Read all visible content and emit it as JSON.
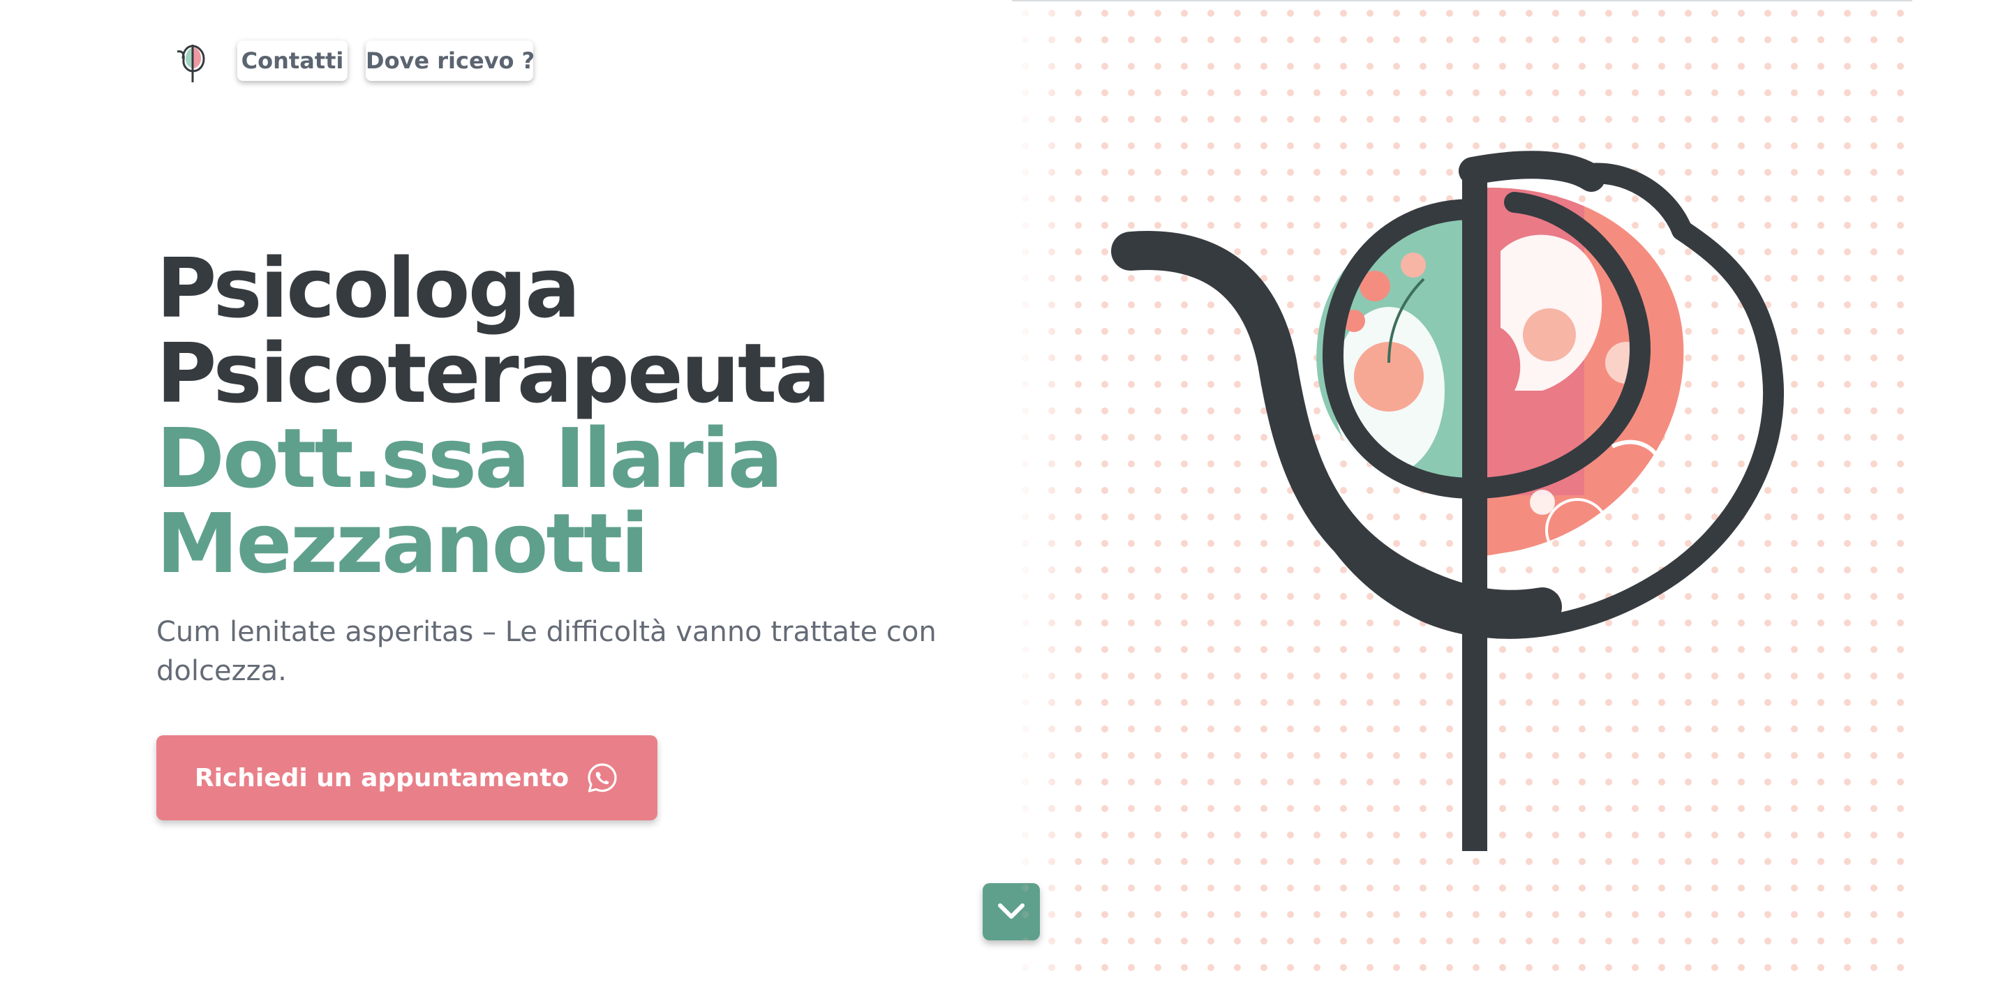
{
  "nav": {
    "contatti_label": "Contatti",
    "dove_label": "Dove ricevo ?"
  },
  "hero": {
    "title_line1": "Psicologa",
    "title_line2": "Psicoterapeuta",
    "name_line1": "Dott.ssa Ilaria",
    "name_line2": "Mezzanotti",
    "subtitle": "Cum lenitate asperitas – Le difficoltà vanno trattate con dolcezza.",
    "cta_label": "Richiedi un appuntamento",
    "cta_icon": "whatsapp-icon",
    "scroll_icon": "chevron-down-icon"
  },
  "colors": {
    "dark_text": "#363b40",
    "green_accent": "#5fa08c",
    "pink_button": "#e98089",
    "muted_text": "#646b76",
    "dot_color": "#f6c9bd"
  }
}
